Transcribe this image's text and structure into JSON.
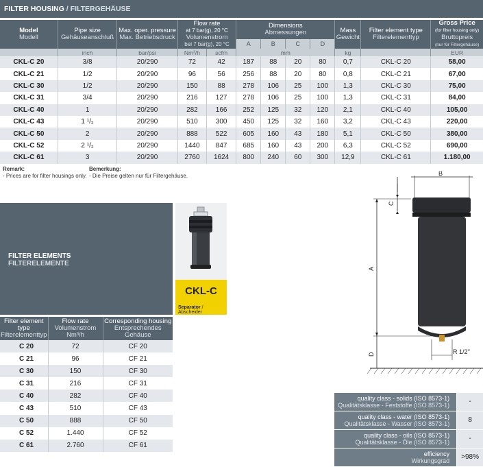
{
  "title": {
    "main": "FILTER HOUSING",
    "sep": " / ",
    "sub": "FILTERGEHÄUSE"
  },
  "main_table": {
    "headers": {
      "model": {
        "en": "Model",
        "de": "Modell"
      },
      "pipe": {
        "en": "Pipe size",
        "de": "Gehäuseanschluß",
        "unit": "inch"
      },
      "pressure": {
        "en": "Max. oper. pressure",
        "de": "Max. Betriebsdruck",
        "unit": "bar/psi"
      },
      "flow": {
        "en": "Flow rate",
        "en2": "at 7 bar(g), 20 °C",
        "de": "Volumenstrom",
        "de2": "bei 7 bar(g), 20 °C",
        "unit1": "Nm³/h",
        "unit2": "scfm"
      },
      "dims": {
        "en": "Dimensions",
        "de": "Abmessungen",
        "cols": [
          "A",
          "B",
          "C",
          "D"
        ],
        "unit": "mm"
      },
      "mass": {
        "en": "Mass",
        "de": "Gewicht",
        "unit": "kg"
      },
      "element": {
        "en": "Filter element type",
        "de": "Filterelementtyp"
      },
      "price": {
        "en": "Gross Price",
        "en2": "(for filter housing only)",
        "de": "Bruttopreis",
        "de2": "(nur für Filtergehäuse)",
        "unit": "EUR"
      }
    },
    "rows": [
      {
        "model": "CKL-C 20",
        "pipe": "3/8",
        "pressure": "20/290",
        "nm3h": "72",
        "scfm": "42",
        "a": "187",
        "b": "88",
        "c": "20",
        "d": "80",
        "mass": "0,7",
        "element": "CKL-C 20",
        "price": "58,00"
      },
      {
        "model": "CKL-C 21",
        "pipe": "1/2",
        "pressure": "20/290",
        "nm3h": "96",
        "scfm": "56",
        "a": "256",
        "b": "88",
        "c": "20",
        "d": "80",
        "mass": "0,8",
        "element": "CKL-C 21",
        "price": "67,00"
      },
      {
        "model": "CKL-C 30",
        "pipe": "1/2",
        "pressure": "20/290",
        "nm3h": "150",
        "scfm": "88",
        "a": "278",
        "b": "106",
        "c": "25",
        "d": "100",
        "mass": "1,3",
        "element": "CKL-C 30",
        "price": "75,00"
      },
      {
        "model": "CKL-C 31",
        "pipe": "3/4",
        "pressure": "20/290",
        "nm3h": "216",
        "scfm": "127",
        "a": "278",
        "b": "106",
        "c": "25",
        "d": "100",
        "mass": "1,3",
        "element": "CKL-C 31",
        "price": "84,00"
      },
      {
        "model": "CKL-C 40",
        "pipe": "1",
        "pressure": "20/290",
        "nm3h": "282",
        "scfm": "166",
        "a": "252",
        "b": "125",
        "c": "32",
        "d": "120",
        "mass": "2,1",
        "element": "CKL-C 40",
        "price": "105,00"
      },
      {
        "model": "CKL-C 43",
        "pipe": "1 ¹/₂",
        "pressure": "20/290",
        "nm3h": "510",
        "scfm": "300",
        "a": "450",
        "b": "125",
        "c": "32",
        "d": "160",
        "mass": "3,2",
        "element": "CKL-C 43",
        "price": "220,00"
      },
      {
        "model": "CKL-C 50",
        "pipe": "2",
        "pressure": "20/290",
        "nm3h": "888",
        "scfm": "522",
        "a": "605",
        "b": "160",
        "c": "43",
        "d": "180",
        "mass": "5,1",
        "element": "CKL-C 50",
        "price": "380,00"
      },
      {
        "model": "CKL-C 52",
        "pipe": "2 ¹/₂",
        "pressure": "20/290",
        "nm3h": "1440",
        "scfm": "847",
        "a": "685",
        "b": "160",
        "c": "43",
        "d": "200",
        "mass": "6,3",
        "element": "CKL-C 52",
        "price": "690,00"
      },
      {
        "model": "CKL-C 61",
        "pipe": "3",
        "pressure": "20/290",
        "nm3h": "2760",
        "scfm": "1624",
        "a": "800",
        "b": "240",
        "c": "60",
        "d": "300",
        "mass": "12,9",
        "element": "CKL-C 61",
        "price": "1.180,00"
      }
    ]
  },
  "remarks": {
    "en_title": "Remark:",
    "en_text": "- Prices are for filter housings only.",
    "de_title": "Bemerkung:",
    "de_text": "- Die Preise gelten nur für Filtergehäuse."
  },
  "filter_elements": {
    "title_en": "FILTER ELEMENTS",
    "title_de": "FILTERELEMENTE",
    "product_name": "CKL-C",
    "product_sub_en": "Separator",
    "product_sub_sep": " / ",
    "product_sub_de": "Abscheider",
    "headers": {
      "type": {
        "en": "Filter element",
        "en2": "type",
        "de": "Filterelementtyp"
      },
      "flow": {
        "en": "Flow rate",
        "de": "Volumenstrom",
        "unit": "Nm³/h"
      },
      "housing": {
        "en": "Corresponding housing",
        "de": "Entsprechendes",
        "de2": "Gehäuse"
      }
    },
    "rows": [
      {
        "type": "C 20",
        "flow": "72",
        "housing": "CF 20"
      },
      {
        "type": "C 21",
        "flow": "96",
        "housing": "CF 21"
      },
      {
        "type": "C 30",
        "flow": "150",
        "housing": "CF 30"
      },
      {
        "type": "C 31",
        "flow": "216",
        "housing": "CF 31"
      },
      {
        "type": "C 40",
        "flow": "282",
        "housing": "CF 40"
      },
      {
        "type": "C 43",
        "flow": "510",
        "housing": "CF 43"
      },
      {
        "type": "C 50",
        "flow": "888",
        "housing": "CF 50"
      },
      {
        "type": "C 52",
        "flow": "1.440",
        "housing": "CF 52"
      },
      {
        "type": "C 61",
        "flow": "2.760",
        "housing": "CF 61"
      }
    ]
  },
  "drawing": {
    "label_a": "A",
    "label_b": "B",
    "label_c": "C",
    "label_d": "D",
    "label_r": "R 1/2''"
  },
  "quality": [
    {
      "en": "quality class - solids (ISO 8573-1)",
      "de": "Qualitätsklasse - Feststoffe (ISO 8573-1)",
      "value": "-"
    },
    {
      "en": "quality class - water (ISO 8573-1)",
      "de": "Qualitätsklasse - Wasser (ISO 8573-1)",
      "value": "8"
    },
    {
      "en": "quality class - oils (ISO 8573-1)",
      "de": "Qualitätsklasse - Öle (ISO 8573-1)",
      "value": "-"
    },
    {
      "en": "efficiency",
      "de": "Wirkungsgrad",
      "value": ">98%"
    }
  ],
  "colors": {
    "header": "#566470",
    "alt_row": "#e4e8ec",
    "label_yellow": "#f2d100"
  }
}
